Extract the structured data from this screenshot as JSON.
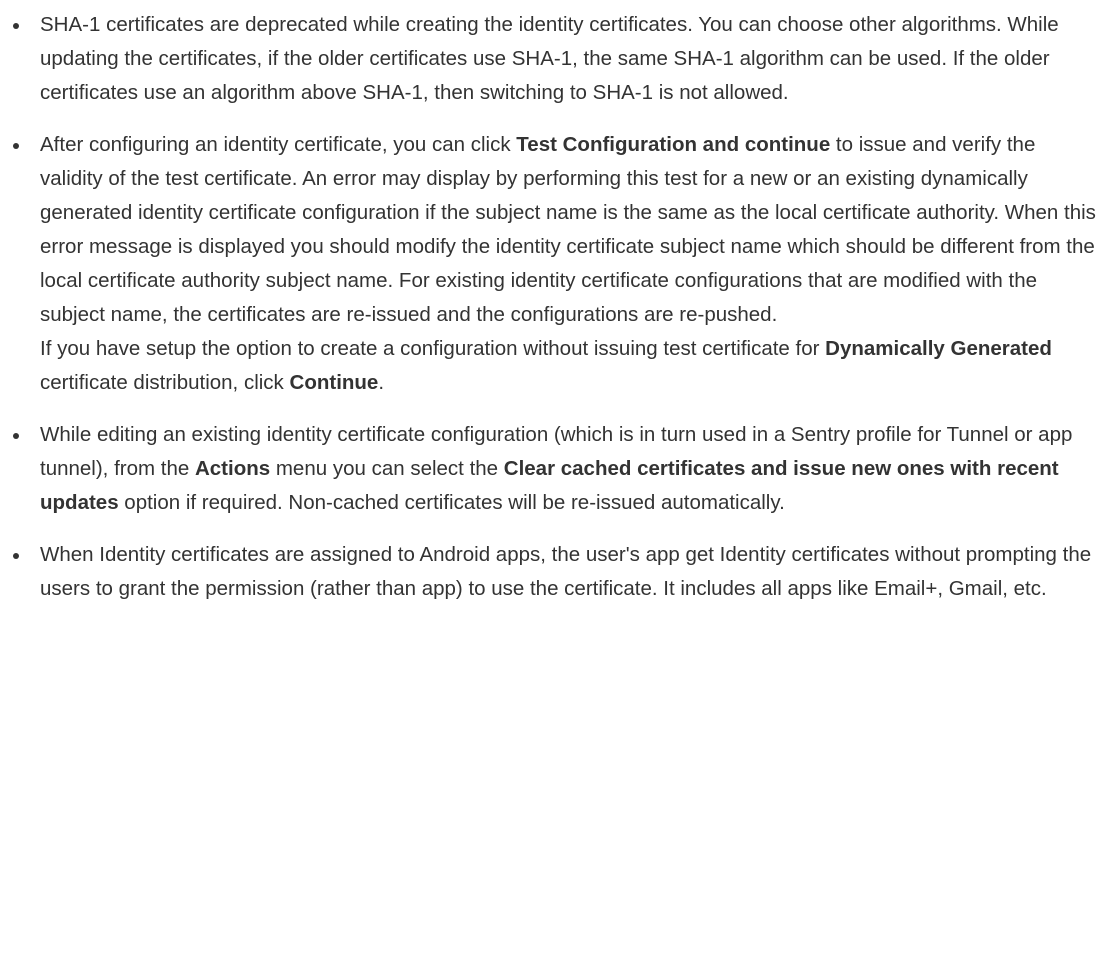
{
  "notes": [
    {
      "text": "SHA-1 certificates are deprecated while creating the identity certificates. You can choose other algorithms. While updating the certificates, if the older certificates use SHA-1, the same SHA-1 algorithm can be used. If the older certificates use an algorithm above SHA-1, then switching to SHA-1 is not allowed."
    },
    {
      "p1_before": "After configuring an identity certificate, you can click ",
      "p1_bold": "Test Configuration and continue",
      "p1_after": " to issue and verify the validity of the test certificate. An error may display by performing this test for a new or an existing dynamically generated identity certificate configuration if the subject name is the same as the local certificate authority. When this error message is displayed you should modify the identity certificate subject name which should be different from the local certificate authority subject name. For existing identity certificate configurations that are modified with the subject name, the certificates are re-issued and the configurations are re-pushed.",
      "p2_before": "If you have setup the option to create a configuration without issuing test certificate for ",
      "p2_bold1": "Dynamically Generated",
      "p2_middle": " certificate distribution, click ",
      "p2_bold2": "Continue",
      "p2_after": "."
    },
    {
      "before": "While editing an existing identity certificate configuration (which is in turn used in a Sentry profile for Tunnel or app tunnel), from the ",
      "bold1": "Actions",
      "middle": " menu you can select the ",
      "bold2": "Clear cached certificates and issue new ones with recent updates",
      "after": " option if required. Non-cached certificates will be re-issued automatically."
    },
    {
      "text": "When Identity certificates are assigned to Android apps, the user's app get Identity certificates without prompting the users to grant the permission (rather than app) to use the certificate. It includes all apps like Email+, Gmail, etc."
    }
  ]
}
